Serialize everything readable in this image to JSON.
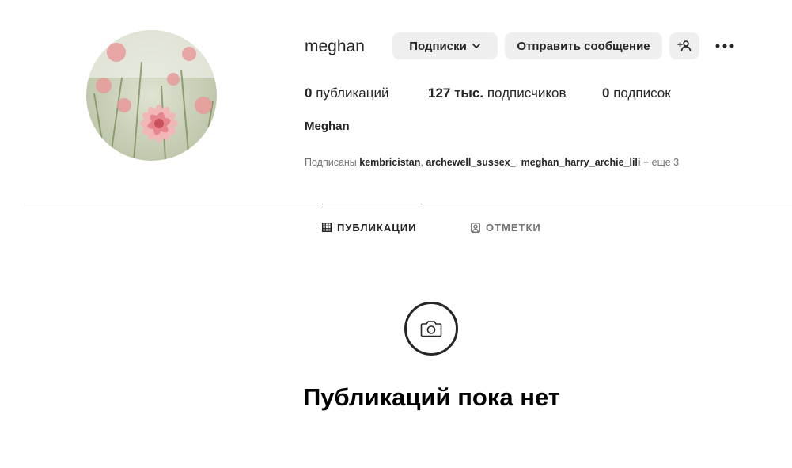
{
  "profile": {
    "username": "meghan",
    "full_name": "Meghan",
    "avatar_icon": "dahlia-flower-photo"
  },
  "actions": {
    "following_label": "Подписки",
    "message_label": "Отправить сообщение",
    "add_user_icon": "add-user-icon",
    "more_icon": "more-horizontal-icon"
  },
  "stats": {
    "posts_count": "0",
    "posts_label": " публикаций",
    "followers_count": "127 тыс.",
    "followers_label": " подписчиков",
    "following_count": "0",
    "following_label": " подписок"
  },
  "followed_by": {
    "prefix": "Подписаны ",
    "accounts": [
      "kembricistan",
      "archewell_sussex_",
      "meghan_harry_archie_lili"
    ],
    "suffix": " + еще 3"
  },
  "tabs": [
    {
      "label": "ПУБЛИКАЦИИ",
      "icon": "grid-icon",
      "active": true
    },
    {
      "label": "ОТМЕТКИ",
      "icon": "tagged-user-icon",
      "active": false
    }
  ],
  "empty_state": {
    "icon": "camera-icon",
    "title": "Публикаций пока нет"
  },
  "colors": {
    "text": "#262626",
    "muted": "#737373",
    "button_bg": "#efefef",
    "divider": "#dbdbdb"
  }
}
